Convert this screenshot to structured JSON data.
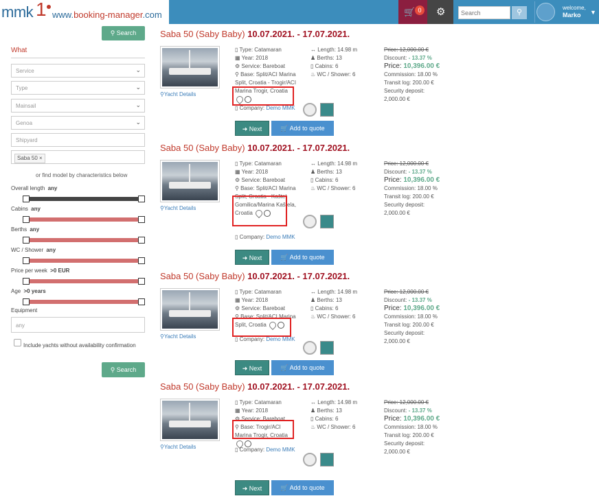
{
  "header": {
    "logo_text": "mmk",
    "logo_sup": "1",
    "logo_url_prefix": "www.",
    "logo_url_brand": "booking-manager",
    "logo_url_suffix": ".com",
    "cart_count": "0",
    "search_placeholder": "Search",
    "welcome": "welcome,",
    "user_name": "Marko"
  },
  "sidebar": {
    "search_button": "Search",
    "what_label": "What",
    "service": "Service",
    "type": "Type",
    "mainsail": "Mainsail",
    "genoa": "Genoa",
    "shipyard": "Shipyard",
    "model_tag": "Saba 50",
    "find_model": "or find model by characteristics below",
    "filters": [
      {
        "label": "Overall length",
        "value": "any",
        "min": 0,
        "max": 1,
        "dark": true
      },
      {
        "label": "Cabins",
        "value": "any",
        "min": 0,
        "max": 1
      },
      {
        "label": "Berths",
        "value": "any",
        "min": 0,
        "max": 1
      },
      {
        "label": "WC / Shower",
        "value": "any",
        "min": 0,
        "max": 1
      },
      {
        "label": "Price per week",
        "value": ">0 EUR",
        "min": 0,
        "max": 1
      },
      {
        "label": "Age",
        "value": ">0 years",
        "min": 0,
        "max": 1
      }
    ],
    "equipment_label": "Equipment",
    "equipment_placeholder": "any",
    "include_text": "Include yachts without availability confirmation",
    "search_button_bottom": "Search"
  },
  "results": [
    {
      "name": "Saba 50 (Saby Baby)",
      "dates": "10.07.2021. - 17.07.2021.",
      "yacht_details": "Yacht Details",
      "type": "Type: Catamaran",
      "year": "Year: 2018",
      "service": "Service: Bareboat",
      "base": "Base: Split/ACI Marina Split,  Croatia -",
      "base2": "Trogir/ACI Marina Trogir,  Croatia",
      "length": "Length: 14.98 m",
      "berths": "Berths: 13",
      "cabins": "Cabins: 6",
      "wc": "WC / Shower: 6",
      "company_label": "Company:",
      "company": "Demo MMK",
      "old_price": "Price: 12,000.00 €",
      "discount_label": "Discount:",
      "discount": "- 13.37 %",
      "price_label": "Price:",
      "price": "10,396.00 €",
      "commission": "Commission: 18.00 %",
      "transit": "Transit log: 200.00 €",
      "security_label": "Security deposit:",
      "security": "2,000.00 €",
      "next": "Next",
      "add": "Add to quote"
    },
    {
      "name": "Saba 50 (Saby Baby)",
      "dates": "10.07.2021. - 17.07.2021.",
      "yacht_details": "Yacht Details",
      "type": "Type: Catamaran",
      "year": "Year: 2018",
      "service": "Service: Bareboat",
      "base": "Base: Split/ACI Marina Split,  Croatia -",
      "base2": "Kaštel Gomilica/Marina Kaštela,  Croatia",
      "length": "Length: 14.98 m",
      "berths": "Berths: 13",
      "cabins": "Cabins: 6",
      "wc": "WC / Shower: 6",
      "company_label": "Company:",
      "company": "Demo MMK",
      "old_price": "Price: 12,000.00 €",
      "discount_label": "Discount:",
      "discount": "- 13.37 %",
      "price_label": "Price:",
      "price": "10,396.00 €",
      "commission": "Commission: 18.00 %",
      "transit": "Transit log: 200.00 €",
      "security_label": "Security deposit:",
      "security": "2,000.00 €",
      "next": "Next",
      "add": "Add to quote"
    },
    {
      "name": "Saba 50 (Saby Baby)",
      "dates": "10.07.2021. - 17.07.2021.",
      "yacht_details": "Yacht Details",
      "type": "Type: Catamaran",
      "year": "Year: 2018",
      "service": "Service: Bareboat",
      "base": "Base: Split/ACI",
      "base2": "Marina Split,  Croatia",
      "length": "Length: 14.98 m",
      "berths": "Berths: 13",
      "cabins": "Cabins: 6",
      "wc": "WC / Shower: 6",
      "company_label": "Company:",
      "company": "Demo MMK",
      "old_price": "Price: 12,000.00 €",
      "discount_label": "Discount:",
      "discount": "- 13.37 %",
      "price_label": "Price:",
      "price": "10,396.00 €",
      "commission": "Commission: 18.00 %",
      "transit": "Transit log: 200.00 €",
      "security_label": "Security deposit:",
      "security": "2,000.00 €",
      "next": "Next",
      "add": "Add to quote"
    },
    {
      "name": "Saba 50 (Saby Baby)",
      "dates": "10.07.2021. - 17.07.2021.",
      "yacht_details": "Yacht Details",
      "type": "Type: Catamaran",
      "year": "Year: 2018",
      "service": "Service: Bareboat",
      "base": "Base: Trogir/ACI",
      "base2": "Marina Trogir,  Croatia",
      "length": "Length: 14.98 m",
      "berths": "Berths: 13",
      "cabins": "Cabins: 6",
      "wc": "WC / Shower: 6",
      "company_label": "Company:",
      "company": "Demo MMK",
      "old_price": "Price: 12,000.00 €",
      "discount_label": "Discount:",
      "discount": "- 13.37 %",
      "price_label": "Price:",
      "price": "10,396.00 €",
      "commission": "Commission: 18.00 %",
      "transit": "Transit log: 200.00 €",
      "security_label": "Security deposit:",
      "security": "2,000.00 €",
      "next": "Next",
      "add": "Add to quote"
    }
  ]
}
